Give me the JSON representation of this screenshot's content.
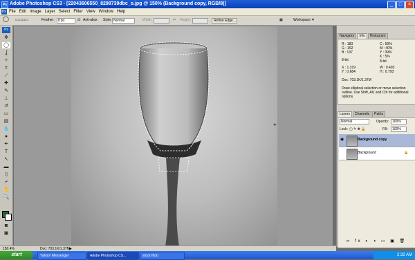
{
  "window": {
    "title": "Adobe Photoshop CS3 - [22043606550_8298739dbc_o.jpg @ 150% (Background copy, RGB/8)]"
  },
  "menu": [
    "File",
    "Edit",
    "Image",
    "Layer",
    "Select",
    "Filter",
    "View",
    "Window",
    "Help"
  ],
  "options": {
    "feather_label": "Feather:",
    "feather_value": "0 px",
    "antialias_label": "Anti-alias",
    "style_label": "Style:",
    "style_value": "Normal",
    "width_label": "Width:",
    "height_label": "Height:",
    "refine_edge": "Refine Edge...",
    "workspace": "Workspace"
  },
  "status": {
    "zoom": "150.4%",
    "doc": "Doc: 703.1K/1.37M"
  },
  "info_panel": {
    "tabs": [
      "Navigator",
      "Info",
      "Histogram"
    ],
    "rgb": {
      "r": "R : 183",
      "g": "G : 152",
      "b": "B : 137"
    },
    "cmyk": {
      "c": "C : 50%",
      "m": "M : 40%",
      "y": "Y : 39%",
      "k": "K : 5%"
    },
    "bit_left": "8-bit",
    "bit_right": "8-bit",
    "xy": {
      "x": "X : 1.319",
      "y": "Y : 0.684"
    },
    "wh": {
      "w": "W : 0.493",
      "h": "H : 0.793"
    },
    "doc": "Doc: 703.1K/1.37M",
    "hint": "Draw elliptical selection or move selection outline.  Use Shift, Alt, and Ctrl for additional options."
  },
  "layers_panel": {
    "tabs": [
      "Layers",
      "Channels",
      "Paths"
    ],
    "blend": "Normal",
    "opacity_label": "Opacity:",
    "opacity": "100%",
    "lock_label": "Lock:",
    "fill_label": "Fill:",
    "fill": "100%",
    "layers": [
      {
        "name": "Background copy"
      },
      {
        "name": "Background"
      }
    ]
  },
  "taskbar": {
    "start": "start",
    "buttons": [
      "Yahoo! Messenger",
      "Adobe Photoshop CS...",
      "stock flickr"
    ],
    "time": "2:32 AM"
  }
}
